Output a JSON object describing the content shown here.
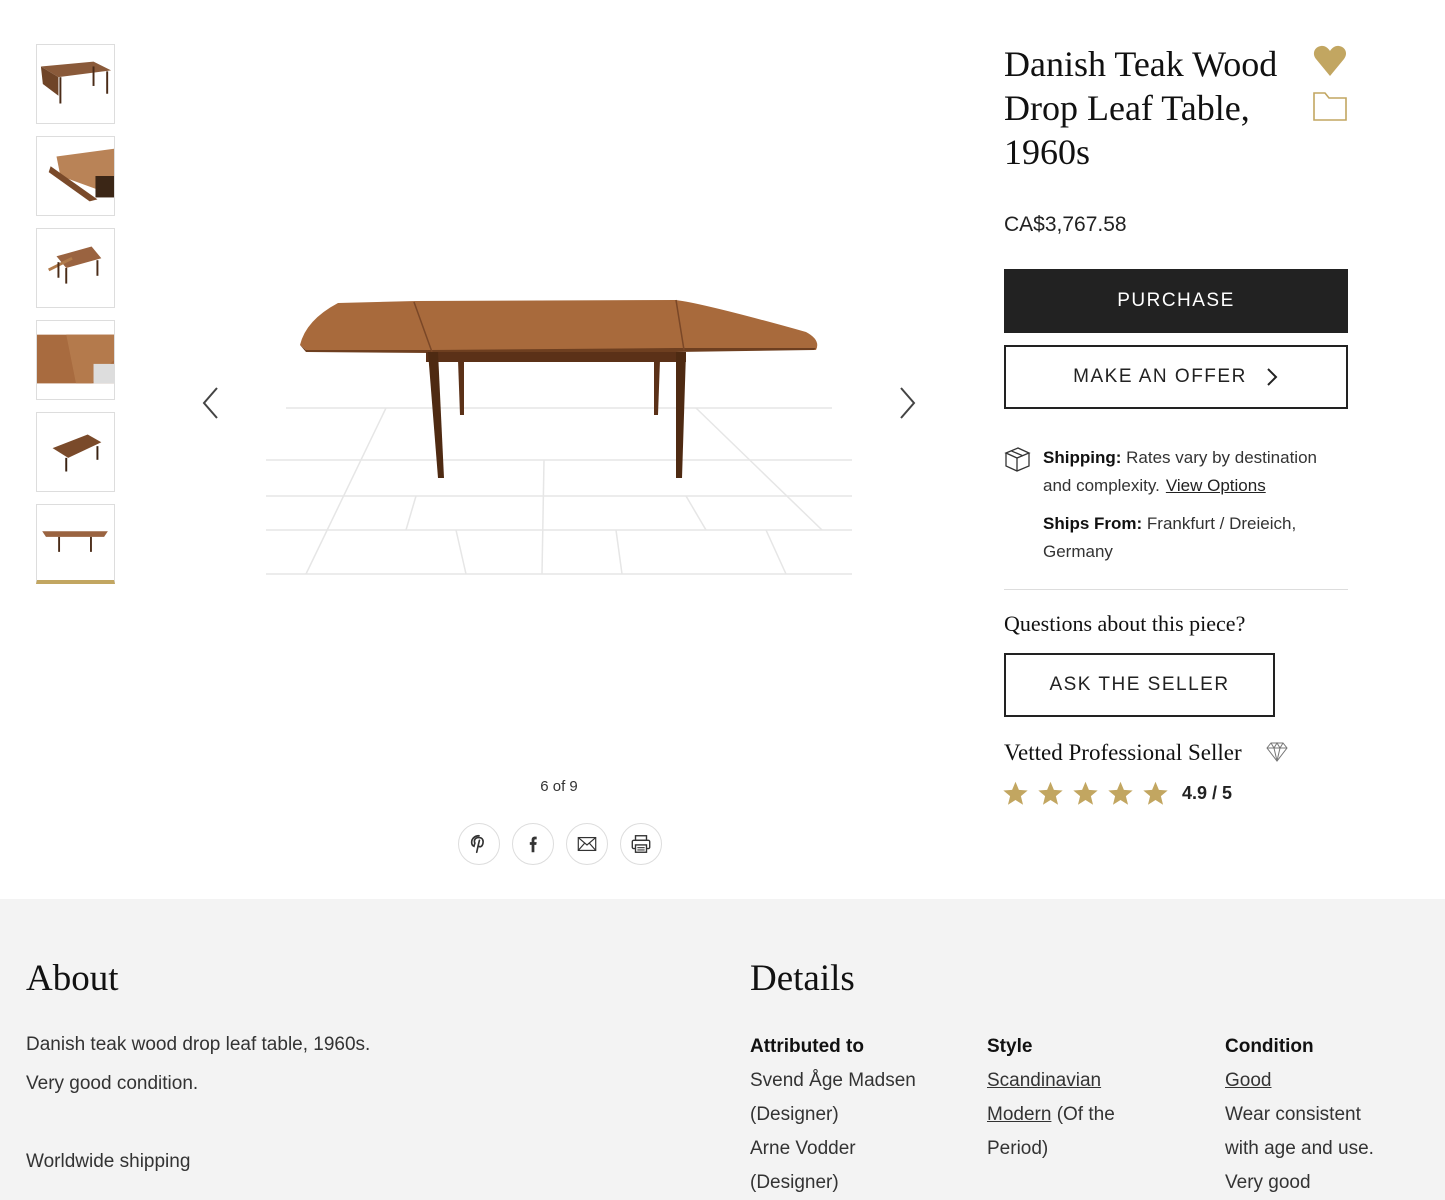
{
  "thumbnails": [
    {
      "alt": "thumbnail 1"
    },
    {
      "alt": "thumbnail 2"
    },
    {
      "alt": "thumbnail 3"
    },
    {
      "alt": "thumbnail 4"
    },
    {
      "alt": "thumbnail 5"
    },
    {
      "alt": "thumbnail 6",
      "active": true
    }
  ],
  "gallery": {
    "counter": "6 of 9",
    "share_icons": [
      "pinterest-icon",
      "facebook-icon",
      "email-icon",
      "print-icon"
    ]
  },
  "product": {
    "title_line1": "Danish Teak Wood",
    "title_line2": "Drop Leaf Table,",
    "title_line3": "1960s",
    "price": "CA$3,767.58",
    "purchase_label": "PURCHASE",
    "offer_label": "MAKE AN OFFER",
    "favorite_icon": "heart-icon",
    "collection_icon": "folder-icon"
  },
  "shipping": {
    "label": "Shipping:",
    "text": "Rates vary by destination and complexity.",
    "link": "View Options",
    "from_label": "Ships From:",
    "from_value": "Frankfurt / Dreieich, Germany"
  },
  "seller": {
    "questions": "Questions about this piece?",
    "ask_label": "ASK THE SELLER",
    "vetted": "Vetted Professional Seller",
    "rating_text": "4.9 / 5",
    "rating_value": 4.9,
    "star_count": 5
  },
  "about": {
    "heading": "About",
    "line1": "Danish teak wood drop leaf table, 1960s.",
    "line2": "Very good condition.",
    "line3": "Worldwide shipping"
  },
  "details": {
    "heading": "Details",
    "attributed_heading": "Attributed to",
    "designer1": "Svend Åge Madsen",
    "designer1_role": "(Designer)",
    "designer2": "Arne Vodder",
    "designer2_role": "(Designer)",
    "style_heading": "Style",
    "style_link1": "Scandinavian",
    "style_link2": "Modern",
    "style_suffix1": "(Of the",
    "style_suffix2": "Period)",
    "condition_heading": "Condition",
    "condition_link": "Good",
    "condition_text1": "Wear consistent",
    "condition_text2": "with age and use.",
    "condition_text3": "Very good"
  },
  "colors": {
    "accent_gold": "#c2a661",
    "dark": "#222222",
    "section_bg": "#f3f3f3"
  }
}
